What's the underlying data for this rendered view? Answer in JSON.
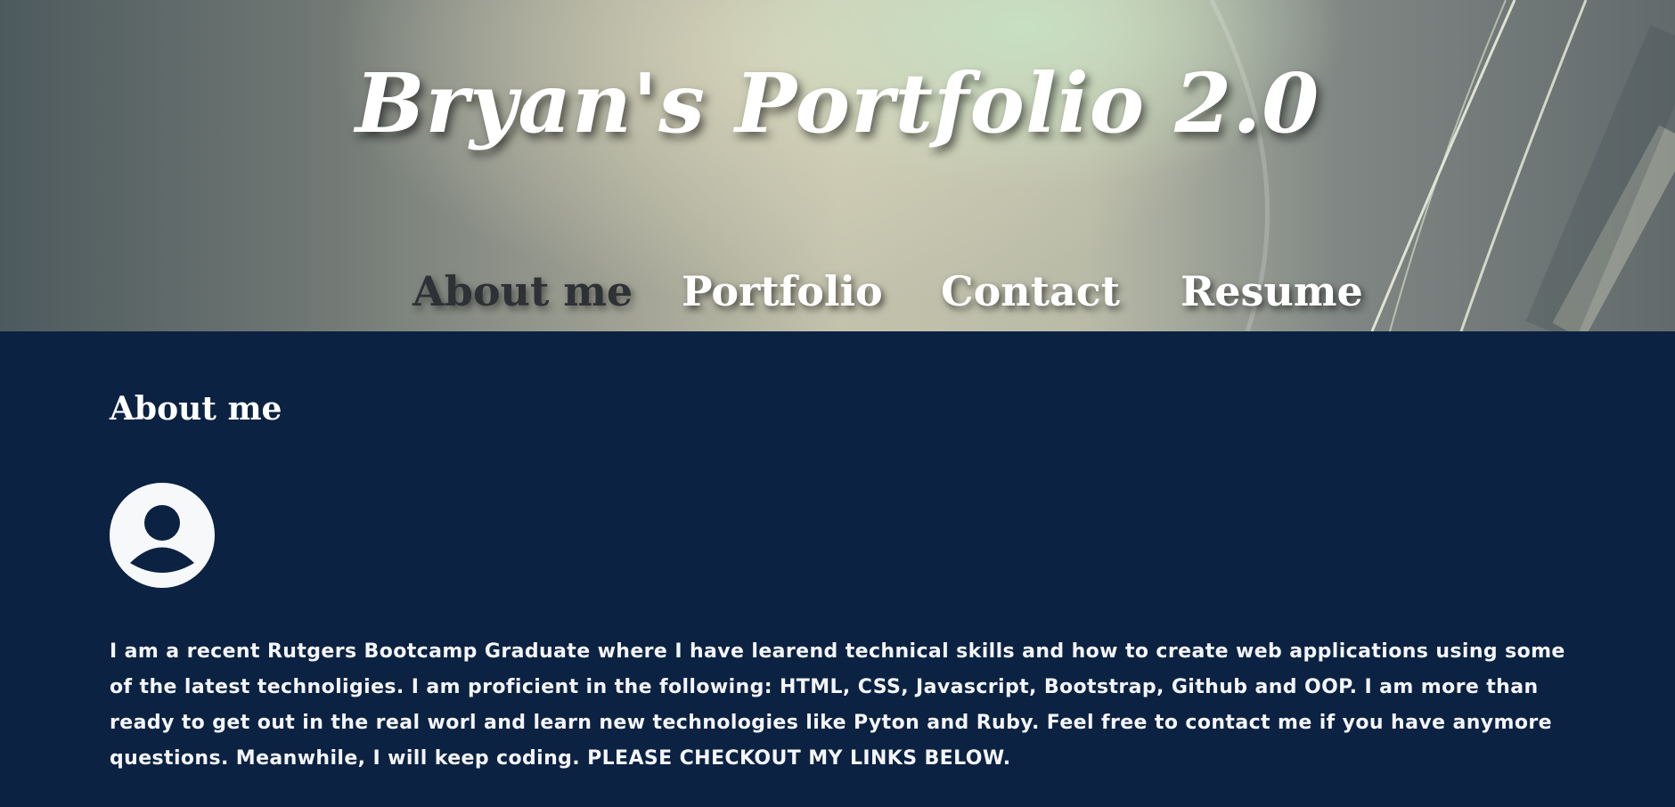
{
  "header": {
    "title": "Bryan's Portfolio 2.0"
  },
  "nav": {
    "items": [
      {
        "label": "About me",
        "active": true
      },
      {
        "label": "Portfolio",
        "active": false
      },
      {
        "label": "Contact",
        "active": false
      },
      {
        "label": "Resume",
        "active": false
      }
    ]
  },
  "about": {
    "heading": "About me",
    "avatar_icon": "user-avatar-icon",
    "bio": "I am a recent Rutgers Bootcamp Graduate where I have learend technical skills and how to create web applications using some of the latest technoligies. I am proficient in the following: HTML, CSS, Javascript, Bootstrap, Github and OOP. I am more than ready to get out in the real worl and learn new technologies like Pyton and Ruby. Feel free to contact me if you have anymore questions. Meanwhile, I will keep coding. PLEASE CHECKOUT MY LINKS BELOW."
  },
  "colors": {
    "page_background": "#0b2242",
    "active_nav": "#2e3136",
    "text": "#ffffff"
  }
}
